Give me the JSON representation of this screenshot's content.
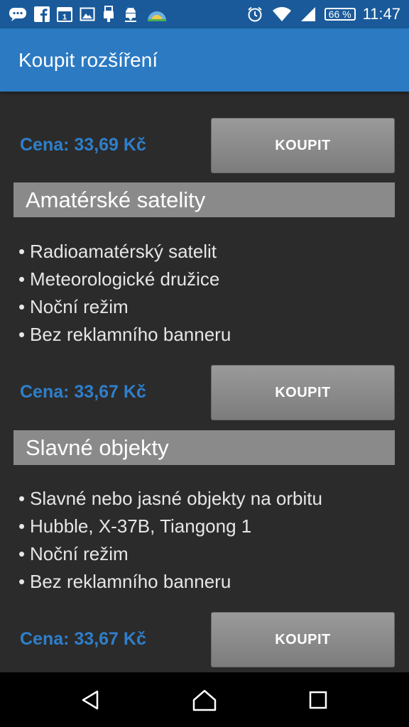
{
  "status_bar": {
    "battery": "66 %",
    "time": "11:47",
    "icons_left": [
      "chat-icon",
      "facebook-icon",
      "calendar-icon",
      "image-icon",
      "usb-icon",
      "android-download-icon",
      "weather-icon"
    ],
    "icons_right": [
      "alarm-icon",
      "wifi-icon",
      "signal-icon"
    ]
  },
  "app_bar": {
    "title": "Koupit rozšíření"
  },
  "products": [
    {
      "price": "Cena: 33,69 Kč",
      "buy_label": "KOUPIT"
    },
    {
      "price": "Cena: 33,67 Kč",
      "buy_label": "KOUPIT",
      "header": "Amatérské satelity",
      "features": [
        "Radioamatérský satelit",
        "Meteorologické družice",
        "Noční režim",
        "Bez reklamního banneru"
      ]
    },
    {
      "price": "Cena: 33,67 Kč",
      "buy_label": "KOUPIT",
      "header": "Slavné objekty",
      "features": [
        "Slavné nebo jasné objekty na orbitu",
        "Hubble, X-37B, Tiangong 1",
        "Noční režim",
        "Bez reklamního banneru"
      ]
    }
  ],
  "bullet": "•",
  "colors": {
    "status_bar": "#1a5a9a",
    "app_bar": "#2b7ac2",
    "background": "#2b2b2b",
    "price": "#2f7fca",
    "button": "#8a8a8a",
    "header": "#8a8a8a"
  },
  "nav": [
    "back-icon",
    "home-icon",
    "recents-icon"
  ]
}
